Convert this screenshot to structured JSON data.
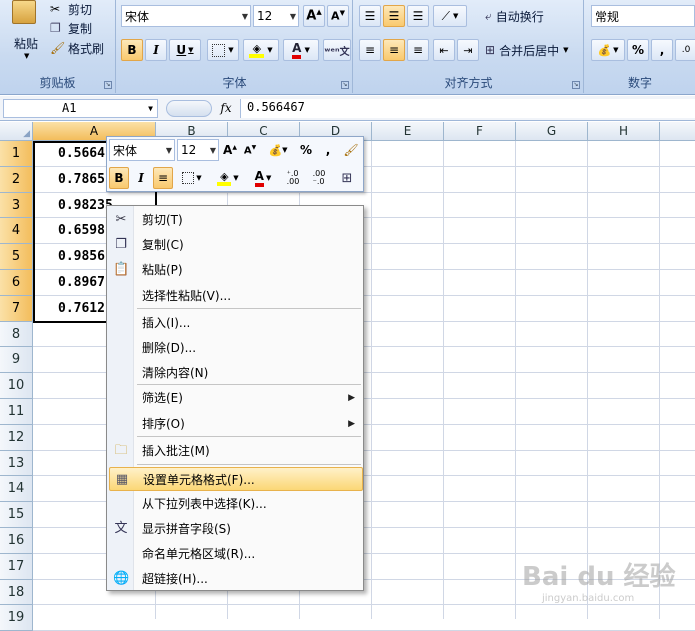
{
  "ribbon": {
    "clipboard": {
      "title": "剪贴板",
      "paste": "粘贴",
      "cut": "剪切",
      "copy": "复制",
      "format_painter": "格式刷"
    },
    "font": {
      "title": "字体",
      "name": "宋体",
      "size": "12",
      "bold": "B",
      "italic": "I",
      "underline": "U",
      "font_color": "A",
      "wen": "文"
    },
    "alignment": {
      "title": "对齐方式",
      "wrap": "自动换行",
      "merge": "合并后居中"
    },
    "number": {
      "title": "数字",
      "format": "常规",
      "percent": "%",
      "comma": ","
    }
  },
  "formula_bar": {
    "name_box": "A1",
    "fx": "fx",
    "value": "0.566467"
  },
  "columns": [
    "A",
    "B",
    "C",
    "D",
    "E",
    "F",
    "G",
    "H"
  ],
  "rows": [
    "1",
    "2",
    "3",
    "4",
    "5",
    "6",
    "7",
    "8",
    "9",
    "10",
    "11",
    "12",
    "13",
    "14",
    "15",
    "16",
    "17",
    "18",
    "19"
  ],
  "cells": [
    "0.5664",
    "0.7865",
    "0.98235",
    "0.6598",
    "0.9856",
    "0.8967",
    "0.7612"
  ],
  "mini_toolbar": {
    "font": "宋体",
    "size": "12",
    "percent": "%",
    "comma": ",",
    "bold": "B",
    "italic": "I",
    "inc_decimal": "+.0 .00",
    "dec_decimal": ".00 +.0"
  },
  "context_menu": [
    {
      "label": "剪切(T)",
      "icon": "scissors-icon"
    },
    {
      "label": "复制(C)",
      "icon": "copy-icon"
    },
    {
      "label": "粘贴(P)",
      "icon": "paste-icon"
    },
    {
      "label": "选择性粘贴(V)...",
      "icon": ""
    },
    {
      "label": "插入(I)...",
      "icon": ""
    },
    {
      "label": "删除(D)...",
      "icon": ""
    },
    {
      "label": "清除内容(N)",
      "icon": ""
    },
    {
      "label": "筛选(E)",
      "icon": "",
      "submenu": true
    },
    {
      "label": "排序(O)",
      "icon": "",
      "submenu": true
    },
    {
      "label": "插入批注(M)",
      "icon": "comment-icon"
    },
    {
      "label": "设置单元格格式(F)...",
      "icon": "format-cells-icon",
      "highlighted": true
    },
    {
      "label": "从下拉列表中选择(K)...",
      "icon": ""
    },
    {
      "label": "显示拼音字段(S)",
      "icon": "pinyin-icon"
    },
    {
      "label": "命名单元格区域(R)...",
      "icon": ""
    },
    {
      "label": "超链接(H)...",
      "icon": "hyperlink-icon"
    }
  ],
  "watermark": {
    "brand": "Bai du 经验",
    "url": "jingyan.baidu.com"
  },
  "colors": {
    "selection_header": "#f3bd5c",
    "menu_highlight": "#fbd776",
    "font_color_underline": "#e00000",
    "highlight_underline": "#ffff00"
  }
}
